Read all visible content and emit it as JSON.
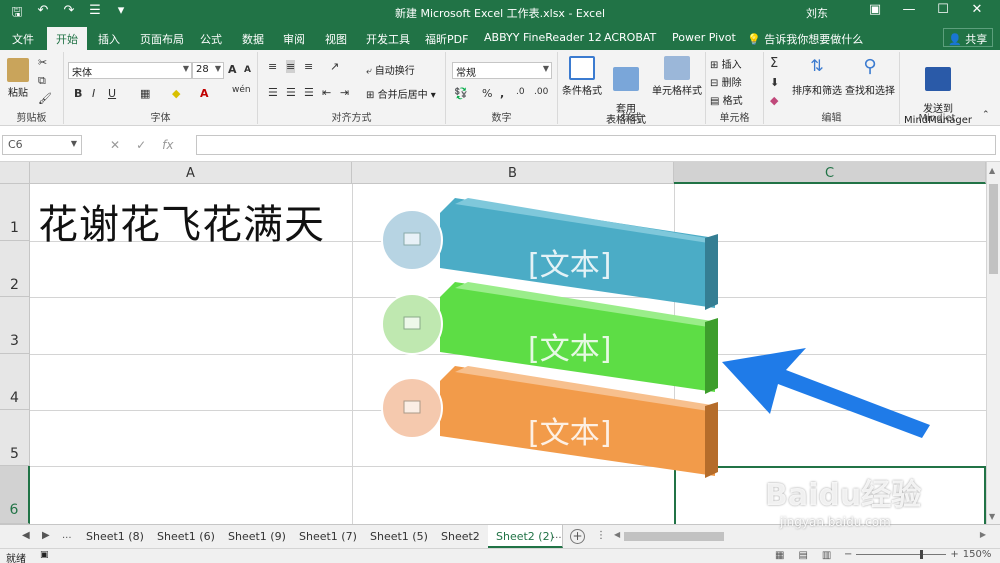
{
  "window": {
    "title": "新建 Microsoft Excel 工作表.xlsx - Excel",
    "user": "刘东",
    "qat": [
      "save",
      "undo",
      "redo",
      "touch",
      "customize"
    ]
  },
  "tabs": [
    "文件",
    "开始",
    "插入",
    "页面布局",
    "公式",
    "数据",
    "审阅",
    "视图",
    "开发工具",
    "福昕PDF",
    "ABBYY FineReader 12",
    "ACROBAT",
    "Power Pivot",
    "告诉我你想要做什么"
  ],
  "active_tab": "开始",
  "share_label": "共享",
  "ribbon": {
    "clipboard": {
      "label": "剪贴板",
      "paste": "粘贴"
    },
    "font": {
      "label": "字体",
      "font_name": "宋体",
      "font_size": "28",
      "bold": "B",
      "italic": "I",
      "underline": "U",
      "grow": "A",
      "shrink": "A",
      "wen": "wén"
    },
    "alignment": {
      "label": "对齐方式",
      "wrap": "自动换行",
      "merge": "合并后居中"
    },
    "number": {
      "label": "数字",
      "format": "常规",
      "percent": "%",
      "comma": ","
    },
    "styles": {
      "label": "样式",
      "conditional": "条件格式",
      "table": "套用\n表格格式",
      "cell_styles": "单元格样式"
    },
    "cells": {
      "label": "单元格",
      "insert": "插入",
      "delete": "删除",
      "format": "格式"
    },
    "editing": {
      "label": "编辑",
      "sort": "排序和筛选",
      "find": "查找和选择"
    },
    "mindjet": {
      "label": "Mindjet",
      "send": "发送到\nMindManager"
    }
  },
  "formula_bar": {
    "name_box": "C6",
    "value": ""
  },
  "columns": [
    "A",
    "B",
    "C"
  ],
  "rows": [
    "1",
    "2",
    "3",
    "4",
    "5",
    "6"
  ],
  "selected_cell": "C6",
  "cells": {
    "A1": "花谢花飞花满天"
  },
  "smartart": {
    "items": [
      {
        "text": "[文本]",
        "color": "#4bacc6",
        "circle": "#b7d4e3"
      },
      {
        "text": "[文本]",
        "color": "#5ddd45",
        "circle": "#bfe8b0"
      },
      {
        "text": "[文本]",
        "color": "#f29b4a",
        "circle": "#f5c9ae"
      }
    ],
    "arrow_color": "#1f7be8"
  },
  "sheets": [
    "Sheet1 (8)",
    "Sheet1 (6)",
    "Sheet1 (9)",
    "Sheet1 (7)",
    "Sheet1 (5)",
    "Sheet2",
    "Sheet2 (2)"
  ],
  "active_sheet": "Sheet2 (2)",
  "status": {
    "ready": "就绪",
    "zoom": "150%"
  },
  "watermark": {
    "brand": "Baidu经验",
    "url": "jingyan.baidu.com"
  }
}
